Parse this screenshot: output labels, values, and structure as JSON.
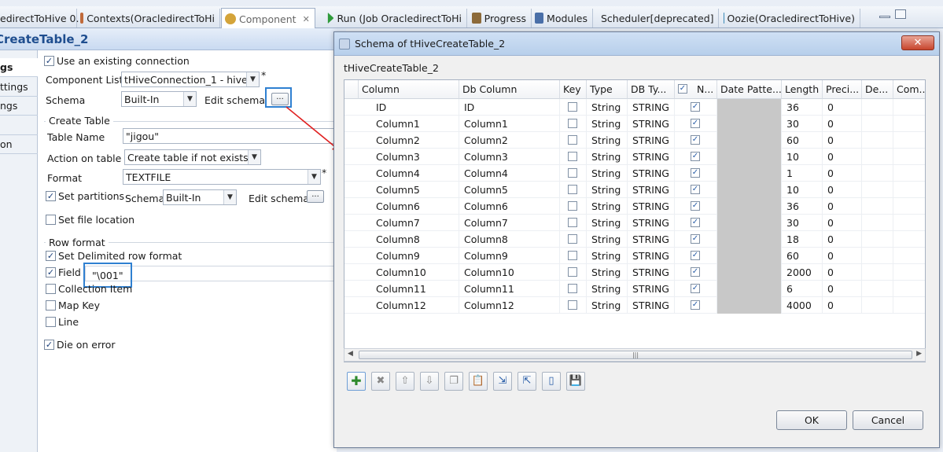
{
  "tabs": [
    {
      "label": "edirectToHive 0.",
      "color": "#c8a24a"
    },
    {
      "label": "Contexts(OracledirectToHi",
      "color": "#c06a3a"
    },
    {
      "label": "Component",
      "color": "#d4a43a",
      "active": true
    },
    {
      "label": "Run (Job OracledirectToHi",
      "color": "#2f9a3a"
    },
    {
      "label": "Progress",
      "color": "#8c6a3a"
    },
    {
      "label": "Modules",
      "color": "#4a6fa8"
    },
    {
      "label": "Scheduler[deprecated]",
      "color": "#4a6fa8"
    },
    {
      "label": "Oozie(OracledirectToHive)",
      "color": "#3a8ab8"
    }
  ],
  "component_title": "CreateTable_2",
  "vtabs": [
    "gs",
    "ttings",
    "ngs",
    "",
    "on"
  ],
  "settings": {
    "use_existing_connection": "Use an existing connection",
    "component_list_label": "Component List",
    "component_list_value": "tHiveConnection_1 - hive",
    "schema_label": "Schema",
    "schema_value": "Built-In",
    "edit_schema_label": "Edit schema",
    "create_table_group": "Create Table",
    "table_name_label": "Table Name",
    "table_name_value": "\"jigou\"",
    "action_label": "Action on table",
    "action_value": "Create table if not exists",
    "format_label": "Format",
    "format_value": "TEXTFILE",
    "set_partitions": "Set partitions",
    "partition_schema_label": "Schema",
    "partition_schema_value": "Built-In",
    "partition_edit_schema": "Edit schema",
    "set_file_location": "Set file location",
    "row_format_group": "Row format",
    "set_delimited": "Set Delimited row format",
    "field_label": "Field",
    "field_value": "\"\\001\"",
    "collection_item": "Collection Item",
    "map_key": "Map Key",
    "line": "Line",
    "die_on_error": "Die on error",
    "required_marker": "*",
    "ellipsis": "..."
  },
  "dialog": {
    "title": "Schema of tHiveCreateTable_2",
    "close": "✕",
    "subtitle": "tHiveCreateTable_2",
    "headers": [
      "Column",
      "Db Column",
      "Key",
      "Type",
      "DB Ty...",
      "N...",
      "Date Patte...",
      "Length",
      "Preci...",
      "De...",
      "Com..."
    ],
    "rows": [
      {
        "column": "ID",
        "db_column": "ID",
        "key": false,
        "type": "String",
        "db_type": "STRING",
        "nullable": true,
        "length": "36",
        "precision": "0"
      },
      {
        "column": "Column1",
        "db_column": "Column1",
        "key": false,
        "type": "String",
        "db_type": "STRING",
        "nullable": true,
        "length": "30",
        "precision": "0"
      },
      {
        "column": "Column2",
        "db_column": "Column2",
        "key": false,
        "type": "String",
        "db_type": "STRING",
        "nullable": true,
        "length": "60",
        "precision": "0"
      },
      {
        "column": "Column3",
        "db_column": "Column3",
        "key": false,
        "type": "String",
        "db_type": "STRING",
        "nullable": true,
        "length": "10",
        "precision": "0"
      },
      {
        "column": "Column4",
        "db_column": "Column4",
        "key": false,
        "type": "String",
        "db_type": "STRING",
        "nullable": true,
        "length": "1",
        "precision": "0"
      },
      {
        "column": "Column5",
        "db_column": "Column5",
        "key": false,
        "type": "String",
        "db_type": "STRING",
        "nullable": true,
        "length": "10",
        "precision": "0"
      },
      {
        "column": "Column6",
        "db_column": "Column6",
        "key": false,
        "type": "String",
        "db_type": "STRING",
        "nullable": true,
        "length": "36",
        "precision": "0"
      },
      {
        "column": "Column7",
        "db_column": "Column7",
        "key": false,
        "type": "String",
        "db_type": "STRING",
        "nullable": true,
        "length": "30",
        "precision": "0"
      },
      {
        "column": "Column8",
        "db_column": "Column8",
        "key": false,
        "type": "String",
        "db_type": "STRING",
        "nullable": true,
        "length": "18",
        "precision": "0"
      },
      {
        "column": "Column9",
        "db_column": "Column9",
        "key": false,
        "type": "String",
        "db_type": "STRING",
        "nullable": true,
        "length": "60",
        "precision": "0"
      },
      {
        "column": "Column10",
        "db_column": "Column10",
        "key": false,
        "type": "String",
        "db_type": "STRING",
        "nullable": true,
        "length": "2000",
        "precision": "0"
      },
      {
        "column": "Column11",
        "db_column": "Column11",
        "key": false,
        "type": "String",
        "db_type": "STRING",
        "nullable": true,
        "length": "6",
        "precision": "0"
      },
      {
        "column": "Column12",
        "db_column": "Column12",
        "key": false,
        "type": "String",
        "db_type": "STRING",
        "nullable": true,
        "length": "4000",
        "precision": "0"
      }
    ],
    "scroll_grip": "|||",
    "toolbar_icons": [
      "add-row-icon",
      "delete-row-icon",
      "move-up-icon",
      "move-down-icon",
      "copy-icon",
      "paste-icon",
      "import-schema-icon",
      "export-schema-icon",
      "reset-icon",
      "save-icon"
    ],
    "ok_label": "OK",
    "cancel_label": "Cancel"
  },
  "colors": {
    "highlight": "#2f80d1",
    "arrow": "#e02020",
    "accent_title": "#1f4e8f"
  }
}
